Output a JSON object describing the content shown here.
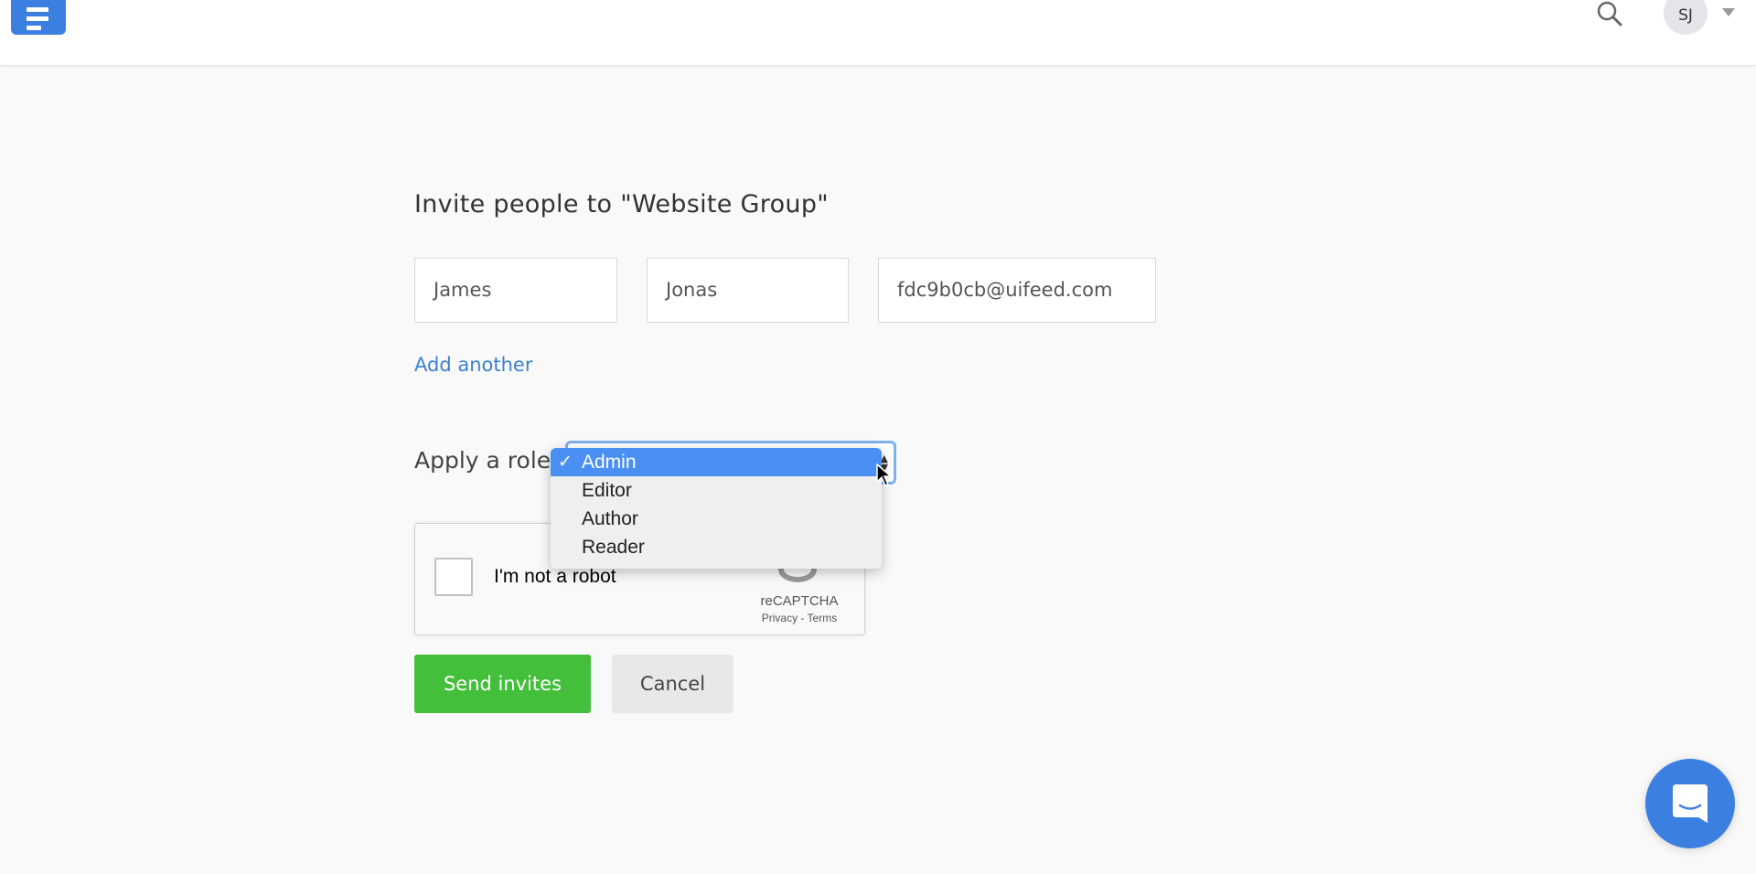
{
  "header": {
    "avatar_initials": "SJ",
    "icons": [
      "app-logo-icon",
      "search-icon",
      "caret-down-icon"
    ]
  },
  "form": {
    "title": "Invite people to \"Website Group\"",
    "first_name_value": "James",
    "last_name_value": "Jonas",
    "email_value": "fdc9b0cb@uifeed.com",
    "add_another_label": "Add another",
    "role_label": "Apply a role",
    "role_options": [
      {
        "label": "Admin",
        "selected": true
      },
      {
        "label": "Editor",
        "selected": false
      },
      {
        "label": "Author",
        "selected": false
      },
      {
        "label": "Reader",
        "selected": false
      }
    ],
    "check_mark": "✓",
    "captcha": {
      "label": "I'm not a robot",
      "brand": "reCAPTCHA",
      "terms": "Privacy - Terms"
    },
    "send_label": "Send invites",
    "cancel_label": "Cancel"
  },
  "colors": {
    "brand_blue": "#3b7fe0",
    "send_green": "#44bf3c",
    "link_blue": "#3b82d0",
    "selected_option": "#4a8ff2"
  }
}
